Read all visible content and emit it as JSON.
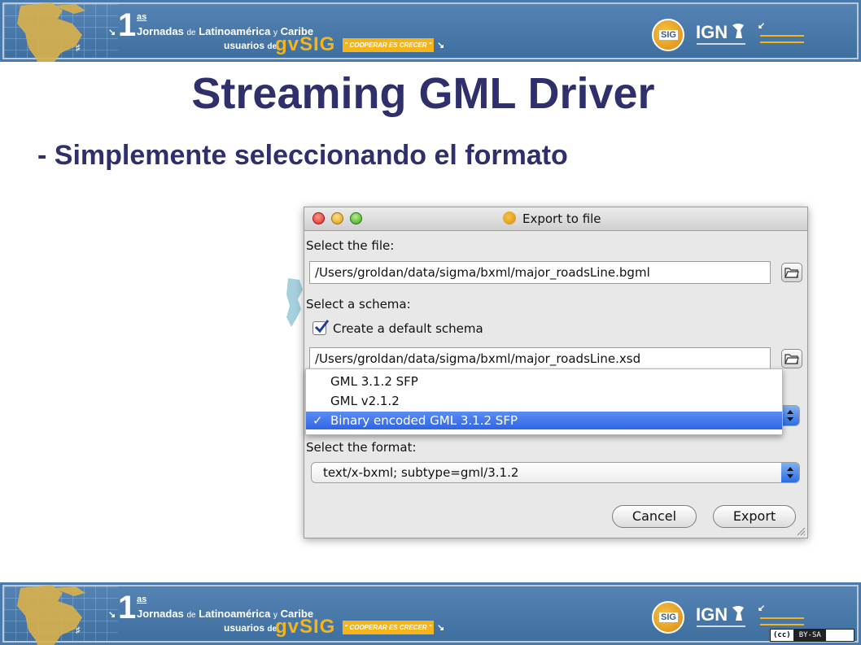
{
  "banner": {
    "ordinal_big": "1",
    "ordinal_sup": "as",
    "jornadas": "Jornadas",
    "de1": "de",
    "latam": "Latinoamérica",
    "y": "y",
    "caribe": "Caribe",
    "usuarios": "usuarios",
    "de2": "de",
    "gvsig": "gvSIG",
    "cooperar": "\" COOPERAR ES CRECER \"",
    "sig_logo": "SIG",
    "ign": "IGN",
    "license_cc": "(cc)",
    "license_bysa": "BY-SA"
  },
  "slide": {
    "title": "Streaming GML Driver",
    "subtitle": "- Simplemente seleccionando el formato"
  },
  "dialog": {
    "title": "Export to file",
    "select_file_label": "Select the file:",
    "file_path": "/Users/groldan/data/sigma/bxml/major_roadsLine.bgml",
    "select_schema_label": "Select a schema:",
    "create_default_schema_label": "Create a default schema",
    "create_default_schema_checked": true,
    "schema_path": "/Users/groldan/data/sigma/bxml/major_roadsLine.xsd",
    "version_options": [
      {
        "label": "GML 3.1.2 SFP",
        "selected": false
      },
      {
        "label": "GML v2.1.2",
        "selected": false
      },
      {
        "label": "Binary encoded GML 3.1.2 SFP",
        "selected": true
      }
    ],
    "select_format_label": "Select the format:",
    "format_value": "text/x-bxml; subtype=gml/3.1.2",
    "cancel_label": "Cancel",
    "export_label": "Export"
  },
  "colors": {
    "banner_blue": "#4a7aab",
    "title_navy": "#2e2f6b",
    "accent_gold": "#f4b41a",
    "selection_blue": "#3a6fe6"
  }
}
